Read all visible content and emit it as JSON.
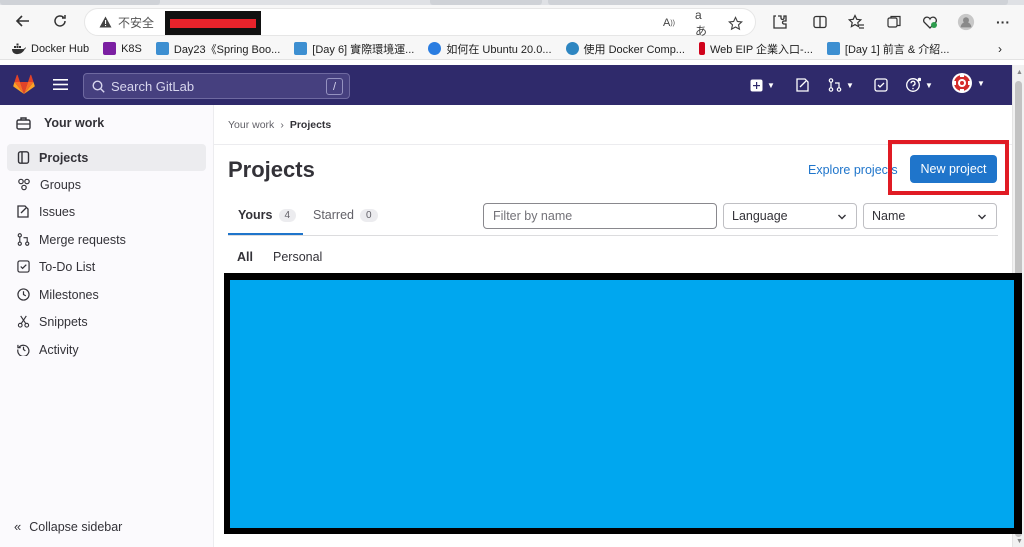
{
  "browser": {
    "url_warning": "不安全",
    "bookmarks": [
      {
        "label": "Docker Hub",
        "color": "#1d63ed"
      },
      {
        "label": "K8S",
        "color": "#7b1fa2"
      },
      {
        "label": "Day23《Spring Boo...",
        "color": "#3d8fd1"
      },
      {
        "label": "[Day 6] 實際環境運...",
        "color": "#3d8fd1"
      },
      {
        "label": "如何在 Ubuntu 20.0...",
        "color": "#2a7de1"
      },
      {
        "label": "使用 Docker Comp...",
        "color": "#2e86c1"
      },
      {
        "label": "Web EIP 企業入口-...",
        "color": "#d0021b"
      },
      {
        "label": "[Day 1] 前言 & 介紹...",
        "color": "#3d8fd1"
      }
    ],
    "redaction_color": "#e8232b"
  },
  "gitlab": {
    "search_placeholder": "Search GitLab",
    "search_shortcut": "/",
    "topbar_color": "#2f2a6b",
    "accent": "#1f75cb"
  },
  "sidebar": {
    "heading": "Your work",
    "items": [
      {
        "label": "Projects",
        "icon": "project-icon",
        "active": true
      },
      {
        "label": "Groups",
        "icon": "group-icon",
        "active": false
      },
      {
        "label": "Issues",
        "icon": "issues-icon",
        "active": false
      },
      {
        "label": "Merge requests",
        "icon": "merge-request-icon",
        "active": false
      },
      {
        "label": "To-Do List",
        "icon": "todo-icon",
        "active": false
      },
      {
        "label": "Milestones",
        "icon": "milestone-icon",
        "active": false
      },
      {
        "label": "Snippets",
        "icon": "snippet-icon",
        "active": false
      },
      {
        "label": "Activity",
        "icon": "activity-icon",
        "active": false
      }
    ],
    "collapse_label": "Collapse sidebar"
  },
  "main": {
    "breadcrumb": [
      "Your work",
      "Projects"
    ],
    "title": "Projects",
    "explore_label": "Explore projects",
    "new_project_label": "New project",
    "tabs": [
      {
        "label": "Yours",
        "count": "4"
      },
      {
        "label": "Starred",
        "count": "0"
      }
    ],
    "filter_placeholder": "Filter by name",
    "language_select": "Language",
    "sort_select": "Name",
    "sub_tabs": [
      "All",
      "Personal"
    ],
    "highlight_color": "#e01b24",
    "redaction_fill": "#00a7ef"
  }
}
